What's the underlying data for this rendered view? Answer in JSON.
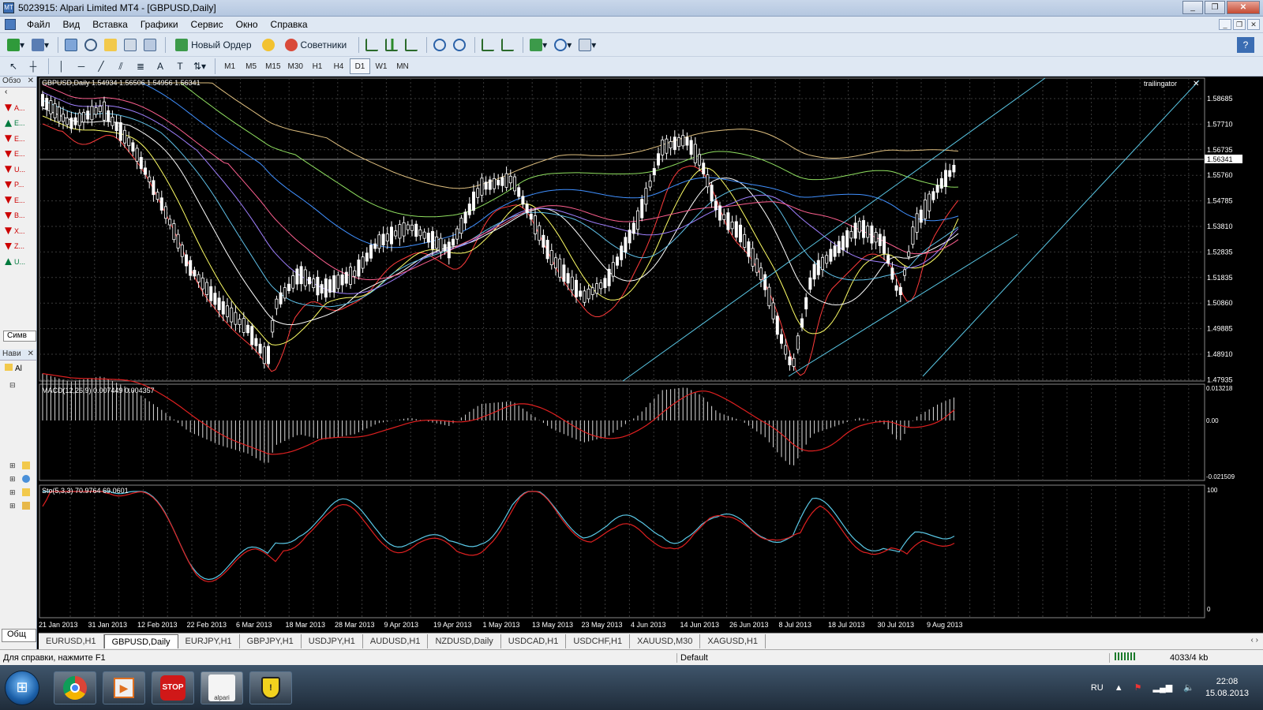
{
  "window": {
    "title": "5023915: Alpari Limited MT4 - [GBPUSD,Daily]",
    "buttons": [
      "_",
      "❐",
      "✕"
    ]
  },
  "menu": {
    "items": [
      "Файл",
      "Вид",
      "Вставка",
      "Графики",
      "Сервис",
      "Окно",
      "Справка"
    ]
  },
  "toolbar": {
    "new_order": "Новый Ордер",
    "experts": "Советники",
    "timeframes": [
      "M1",
      "M5",
      "M15",
      "M30",
      "H1",
      "H4",
      "D1",
      "W1",
      "MN"
    ],
    "active_timeframe": "D1"
  },
  "left_panel": {
    "market_watch_title": "Обзо",
    "symbols_tab": "Симв",
    "navigator_title": "Нави",
    "navigator_item": "Al",
    "general_tab": "Общ",
    "symbol_rows": [
      {
        "label": "A...",
        "color": "#cc0000"
      },
      {
        "label": "E...",
        "color": "#007a3d"
      },
      {
        "label": "E...",
        "color": "#cc0000"
      },
      {
        "label": "E...",
        "color": "#cc0000"
      },
      {
        "label": "U...",
        "color": "#cc0000"
      },
      {
        "label": "P...",
        "color": "#cc0000"
      },
      {
        "label": "E...",
        "color": "#cc0000"
      },
      {
        "label": "B...",
        "color": "#cc0000"
      },
      {
        "label": "X...",
        "color": "#cc0000"
      },
      {
        "label": "Z...",
        "color": "#cc0000"
      },
      {
        "label": "U...",
        "color": "#007a3d"
      }
    ]
  },
  "chart": {
    "header": "GBPUSD,Daily  1.54934 1.56506 1.54956 1.56341",
    "expert": "trailingator",
    "current_price": "1.56341",
    "price_labels": [
      "1.58685",
      "1.57710",
      "1.56735",
      "1.55760",
      "1.54785",
      "1.53810",
      "1.52835",
      "1.51835",
      "1.50860",
      "1.49885",
      "1.48910",
      "1.47935"
    ],
    "date_labels": [
      "21 Jan 2013",
      "31 Jan 2013",
      "12 Feb 2013",
      "22 Feb 2013",
      "6 Mar 2013",
      "18 Mar 2013",
      "28 Mar 2013",
      "9 Apr 2013",
      "19 Apr 2013",
      "1 May 2013",
      "13 May 2013",
      "23 May 2013",
      "4 Jun 2013",
      "14 Jun 2013",
      "26 Jun 2013",
      "8 Jul 2013",
      "18 Jul 2013",
      "30 Jul 2013",
      "9 Aug 2013"
    ],
    "macd_header": "MACD(12,26,9) 0.007449 0.004357",
    "macd_labels": [
      "0.013218",
      "0.00",
      "-0.021509"
    ],
    "stoch_header": "Sto(5,3,3) 70.9764 69.0601",
    "stoch_labels": [
      "100",
      "0"
    ]
  },
  "tabs": [
    "EURUSD,H1",
    "GBPUSD,Daily",
    "EURJPY,H1",
    "GBPJPY,H1",
    "USDJPY,H1",
    "AUDUSD,H1",
    "NZDUSD,Daily",
    "USDCAD,H1",
    "USDCHF,H1",
    "XAUUSD,M30",
    "XAGUSD,H1"
  ],
  "active_tab": "GBPUSD,Daily",
  "status": {
    "help": "Для справки, нажмите F1",
    "profile": "Default",
    "traffic": "4033/4 kb"
  },
  "taskbar": {
    "apps": [
      "chrome-icon",
      "media-player-icon",
      "stop-icon",
      "alpari-icon",
      "shield-icon"
    ],
    "stop_label": "STOP",
    "alpari_label": "alpari",
    "lang": "RU",
    "time": "22:08",
    "date": "15.08.2013"
  }
}
